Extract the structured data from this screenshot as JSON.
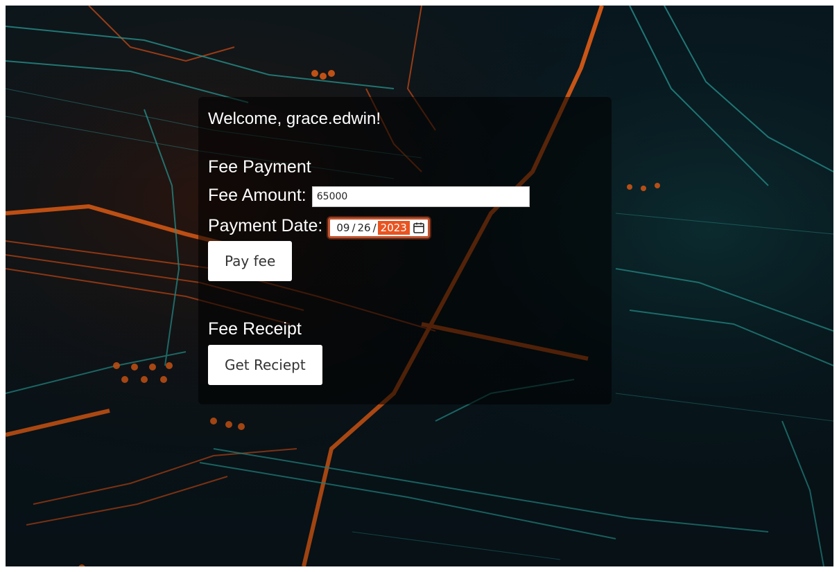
{
  "welcome": {
    "text": "Welcome, grace.edwin!"
  },
  "payment": {
    "title": "Fee Payment",
    "amount_label": "Fee Amount:",
    "amount_value": "65000",
    "date_label": "Payment Date:",
    "date": {
      "month": "09",
      "day": "26",
      "year": "2023",
      "separator": "/"
    },
    "calendar_icon": "calendar-icon",
    "pay_button": "Pay fee"
  },
  "receipt": {
    "title": "Fee Receipt",
    "button": "Get Reciept"
  },
  "colors": {
    "accent": "#e95420",
    "panel_overlay": "rgba(0,0,0,0.55)",
    "background_dark": "#071820",
    "circuit_orange": "#ff6a1a",
    "circuit_teal": "#2fb5b0"
  }
}
